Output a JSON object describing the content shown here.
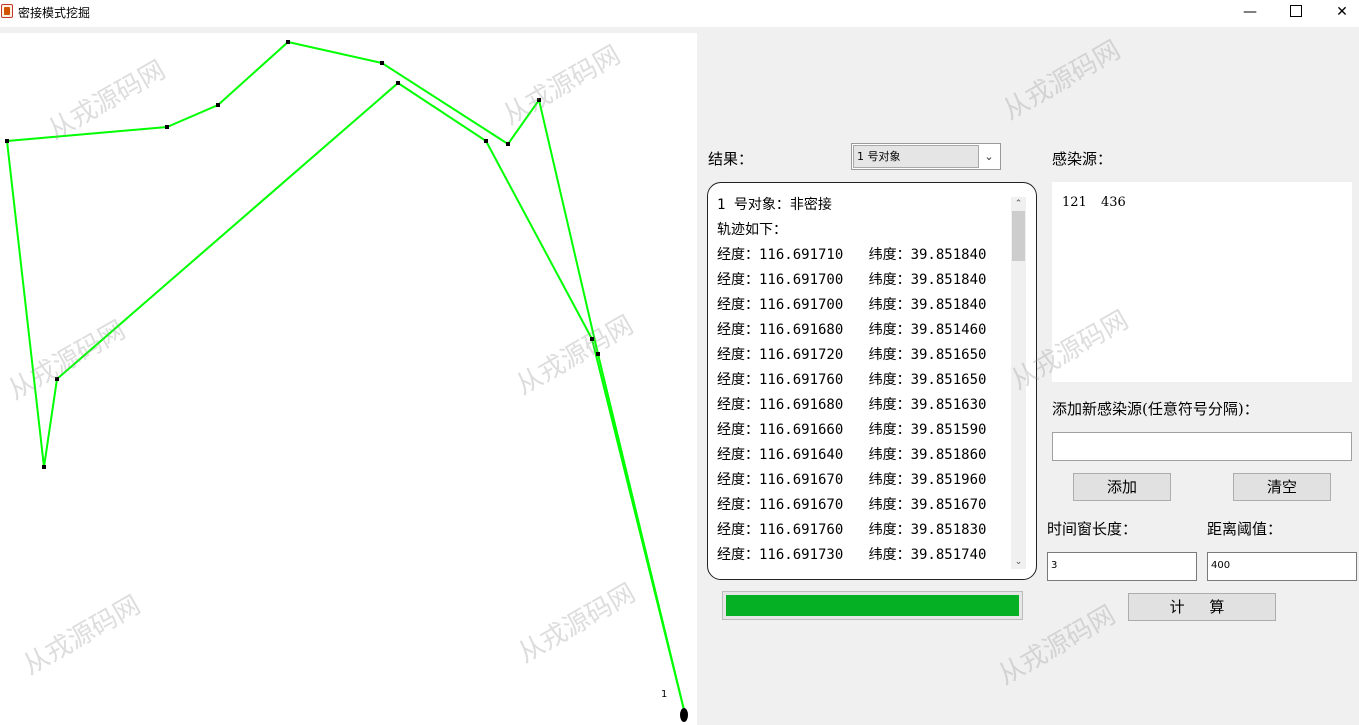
{
  "window": {
    "title": "密接模式挖掘",
    "minimize": "—",
    "close": "✕"
  },
  "result": {
    "label": "结果：",
    "selected_object": "1 号对象",
    "text": "1 号对象：非密接\n轨迹如下：\n经度：116.691710   纬度：39.851840\n经度：116.691700   纬度：39.851840\n经度：116.691700   纬度：39.851840\n经度：116.691680   纬度：39.851460\n经度：116.691720   纬度：39.851650\n经度：116.691760   纬度：39.851650\n经度：116.691680   纬度：39.851630\n经度：116.691660   纬度：39.851590\n经度：116.691640   纬度：39.851860\n经度：116.691670   纬度：39.851960\n经度：116.691670   纬度：39.851670\n经度：116.691760   纬度：39.851830\n经度：116.691730   纬度：39.851740"
  },
  "sources": {
    "label": "感染源：",
    "values": "121   436"
  },
  "add_source": {
    "label": "添加新感染源(任意符号分隔)：",
    "value": ""
  },
  "buttons": {
    "add": "添加",
    "clear": "清空",
    "calc": "计 算"
  },
  "params": {
    "time_label": "时间窗长度：",
    "time_value": "3",
    "dist_label": "距离阈值：",
    "dist_value": "400"
  },
  "progress": {
    "value": 1.0,
    "color": "#06b025"
  },
  "canvas": {
    "object_label": "1",
    "track_color": "#00ff00"
  },
  "watermark": {
    "text": "从戎源码网"
  }
}
